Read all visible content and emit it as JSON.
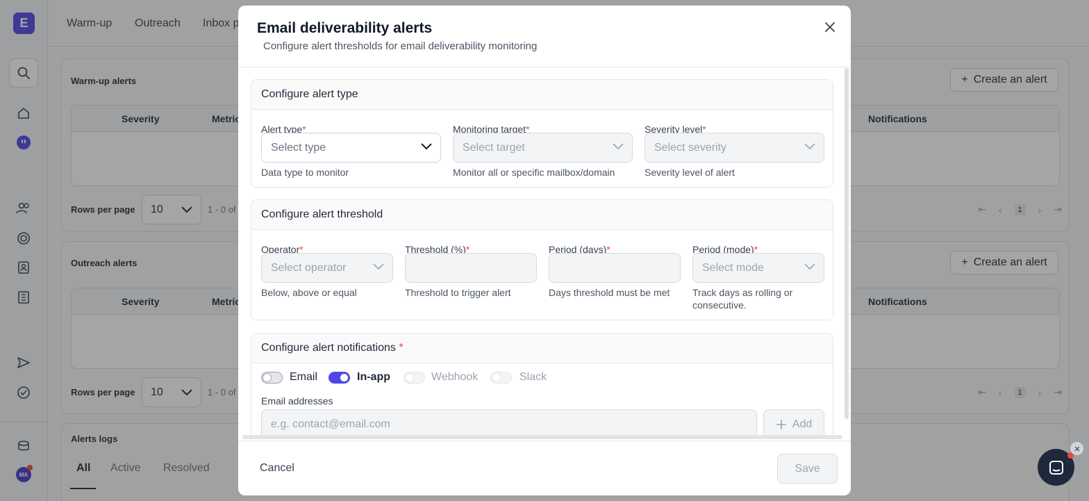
{
  "app": {
    "logo_letter": "E",
    "avatar_initials": "MA",
    "nav_tabs": [
      "Warm-up",
      "Outreach",
      "Inbox p"
    ],
    "warmup_panel": {
      "title": "Warm-up alerts",
      "create_label": "Create an alert",
      "columns": [
        "Severity",
        "Metric",
        "Notifications"
      ],
      "rows_per_page_label": "Rows per page",
      "rows_per_page_value": "10",
      "range": "1 - 0 of",
      "page": "1"
    },
    "outreach_panel": {
      "title": "Outreach alerts",
      "create_label": "Create an alert",
      "columns": [
        "Severity",
        "Metric",
        "Notifications"
      ],
      "rows_per_page_label": "Rows per page",
      "rows_per_page_value": "10",
      "range": "1 - 0 of",
      "page": "1"
    },
    "logs_panel": {
      "title": "Alerts logs",
      "tabs": [
        "All",
        "Active",
        "Resolved"
      ]
    }
  },
  "modal": {
    "title": "Email deliverability alerts",
    "subtitle": "Configure alert thresholds for email deliverability monitoring",
    "type_section": {
      "title": "Configure alert type",
      "fields": [
        {
          "label": "Alert type",
          "placeholder": "Select type",
          "help": "Data type to monitor"
        },
        {
          "label": "Monitoring target",
          "placeholder": "Select target",
          "help": "Monitor all or specific mailbox/domain"
        },
        {
          "label": "Severity level",
          "placeholder": "Select severity",
          "help": "Severity level of alert"
        }
      ]
    },
    "threshold_section": {
      "title": "Configure alert threshold",
      "fields": [
        {
          "label": "Operator",
          "placeholder": "Select operator",
          "help": "Below, above or equal"
        },
        {
          "label": "Threshold (%)",
          "value": "",
          "help": "Threshold to trigger alert"
        },
        {
          "label": "Period (days)",
          "value": "",
          "help": "Days threshold must be met"
        },
        {
          "label": "Period (mode)",
          "placeholder": "Select mode",
          "help_line1": "Track days as rolling or",
          "help_line2": "consecutive."
        }
      ]
    },
    "notifications_section": {
      "title": "Configure alert notifications",
      "required_mark": "*",
      "channels": [
        {
          "name": "Email",
          "enabled": false
        },
        {
          "name": "In-app",
          "enabled": true
        },
        {
          "name": "Webhook",
          "enabled": false
        },
        {
          "name": "Slack",
          "enabled": false
        }
      ],
      "email_label": "Email addresses",
      "email_placeholder": "e.g. contact@email.com",
      "add_label": "Add"
    },
    "required_mark": "*",
    "cancel_label": "Cancel",
    "save_label": "Save"
  },
  "colors": {
    "accent": "#4f46e5",
    "required": "#ef4444",
    "overlay": "rgba(40,40,40,0.42)"
  }
}
